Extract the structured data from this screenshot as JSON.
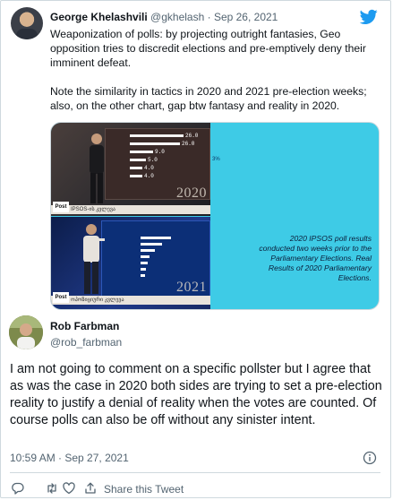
{
  "quoted_tweet": {
    "author_name": "George Khelashvili",
    "author_handle": "@gkhelash",
    "separator": " · ",
    "date": "Sep 26, 2021",
    "paragraph_1": "Weaponization of polls: by projecting outright fantasies, Geo opposition tries to discredit elections and pre-emptively deny their imminent defeat.",
    "paragraph_2": "Note the similarity in tactics in 2020 and 2021 pre-election weeks; also, on the other chart, gap btw fantasy and reality in 2020."
  },
  "media": {
    "top_percentages": [
      "26.0",
      "26.0",
      "9.0",
      "5.0",
      "4.0",
      "4.0"
    ],
    "top_year": "2020",
    "top_caption": "IPSOS-ის კვლევა",
    "bottom_year": "2021",
    "bottom_caption": "ოპოზიციური კვლევა",
    "logo_text": "Post",
    "side_label": "3%",
    "note": "2020 IPSOS poll results conducted two weeks prior to the Parliamentary Elections. Real Results of 2020 Parliamentary Elections."
  },
  "reply": {
    "author_name": "Rob Farbman",
    "author_handle": "@rob_farbman",
    "text": "I am not going to comment on a specific pollster but I agree that as was the case in 2020 both sides are trying to set a pre-election reality to justify a denial of reality when the votes are counted.  Of course polls can also be off without any sinister intent.",
    "timestamp": "10:59 AM · Sep 27, 2021"
  },
  "actions": {
    "share_label": "Share this Tweet"
  },
  "icons": {
    "brand": "twitter-bird-icon",
    "info": "info-icon",
    "reply": "reply-icon",
    "retweet": "retweet-icon",
    "like": "heart-icon",
    "share": "share-icon"
  },
  "colors": {
    "brand": "#1d9bf0",
    "secondary_text": "#536471",
    "border": "#cfd9de"
  }
}
